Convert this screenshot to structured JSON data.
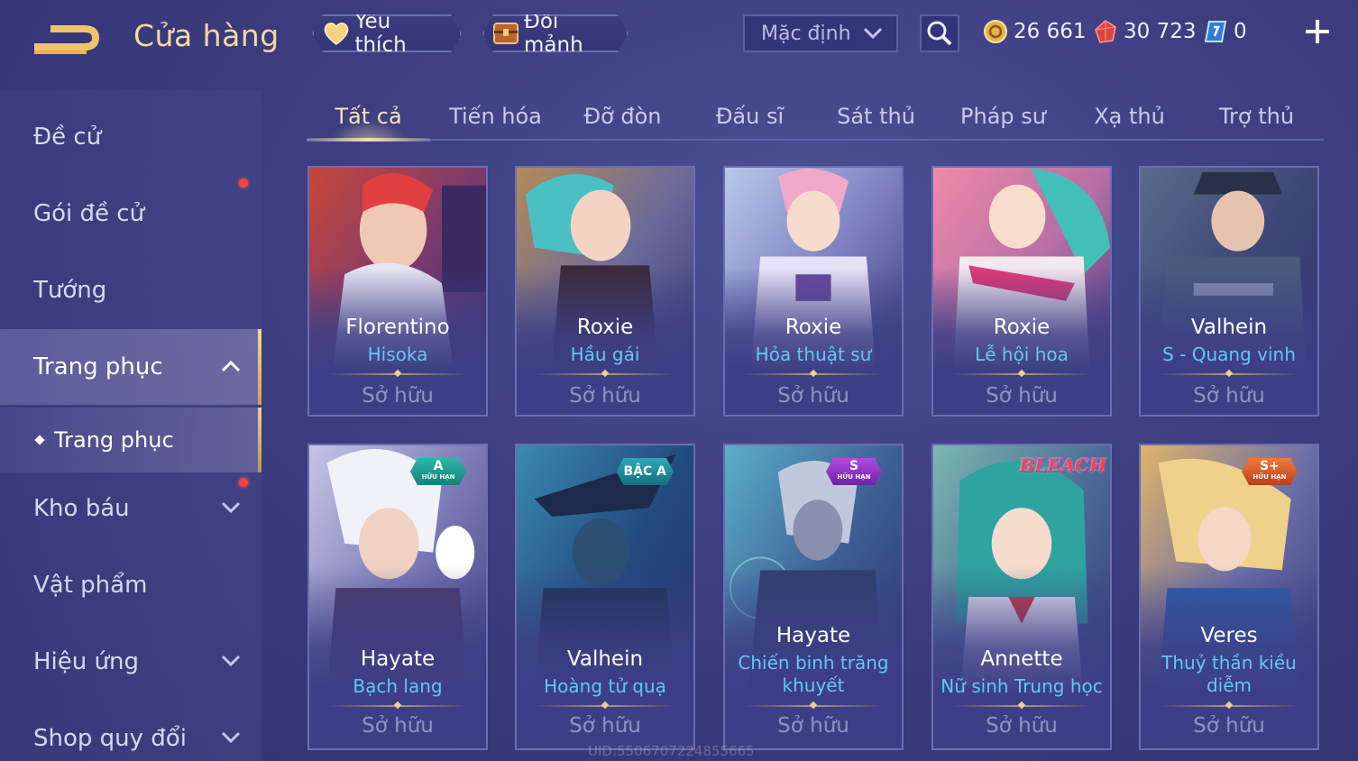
{
  "header": {
    "title": "Cửa hàng",
    "favorites_label": "Yêu thích",
    "shard_exchange_label": "Đổi mảnh",
    "sort_value": "Mặc định",
    "currencies": [
      {
        "icon": "gold-coin-icon",
        "value": "26 661"
      },
      {
        "icon": "ruby-gem-icon",
        "value": "30 723"
      },
      {
        "icon": "voucher-icon",
        "value": "0"
      }
    ]
  },
  "sidebar": {
    "items": [
      {
        "label": "Đề cử"
      },
      {
        "label": "Gói đề cử"
      },
      {
        "label": "Tướng"
      },
      {
        "label": "Trang phục"
      },
      {
        "label": "Kho báu"
      },
      {
        "label": "Vật phẩm"
      },
      {
        "label": "Hiệu ứng"
      },
      {
        "label": "Shop quy đổi"
      }
    ],
    "sub_item": "Trang phục"
  },
  "tabs": [
    "Tất cả",
    "Tiến hóa",
    "Đỡ đòn",
    "Đấu sĩ",
    "Sát thủ",
    "Pháp sư",
    "Xạ thủ",
    "Trợ thủ"
  ],
  "cards": [
    {
      "hero": "Florentino",
      "skin": "Hisoka",
      "status": "Sở hữu",
      "badge": ""
    },
    {
      "hero": "Roxie",
      "skin": "Hầu gái",
      "status": "Sở hữu",
      "badge": ""
    },
    {
      "hero": "Roxie",
      "skin": "Hỏa thuật sư",
      "status": "Sở hữu",
      "badge": ""
    },
    {
      "hero": "Roxie",
      "skin": "Lễ hội hoa",
      "status": "Sở hữu",
      "badge": ""
    },
    {
      "hero": "Valhein",
      "skin": "S - Quang vinh",
      "status": "Sở hữu",
      "badge": ""
    },
    {
      "hero": "Hayate",
      "skin": "Bạch lang",
      "status": "Sở hữu",
      "badge": "A",
      "badge_sub": "HỮU HẠN"
    },
    {
      "hero": "Valhein",
      "skin": "Hoàng tử quạ",
      "status": "Sở hữu",
      "badge": "BẬC A"
    },
    {
      "hero": "Hayate",
      "skin": "Chiến binh trăng khuyết",
      "status": "Sở hữu",
      "badge": "S",
      "badge_sub": "HỮU HẠN"
    },
    {
      "hero": "Annette",
      "skin": "Nữ sinh Trung học",
      "status": "Sở hữu",
      "badge": "",
      "collab": "BLEACH"
    },
    {
      "hero": "Veres",
      "skin": "Thuỷ thần kiều diễm",
      "status": "Sở hữu",
      "badge": "S+",
      "badge_sub": "HỮU HẠN"
    }
  ],
  "footer": {
    "uid": "UID:5506707224855665"
  },
  "colors": {
    "accent_gold": "#f4d9a0",
    "skin_name_cyan": "#63c8f0",
    "owned_gray": "#8f93c2",
    "notification_red": "#ff4040"
  }
}
